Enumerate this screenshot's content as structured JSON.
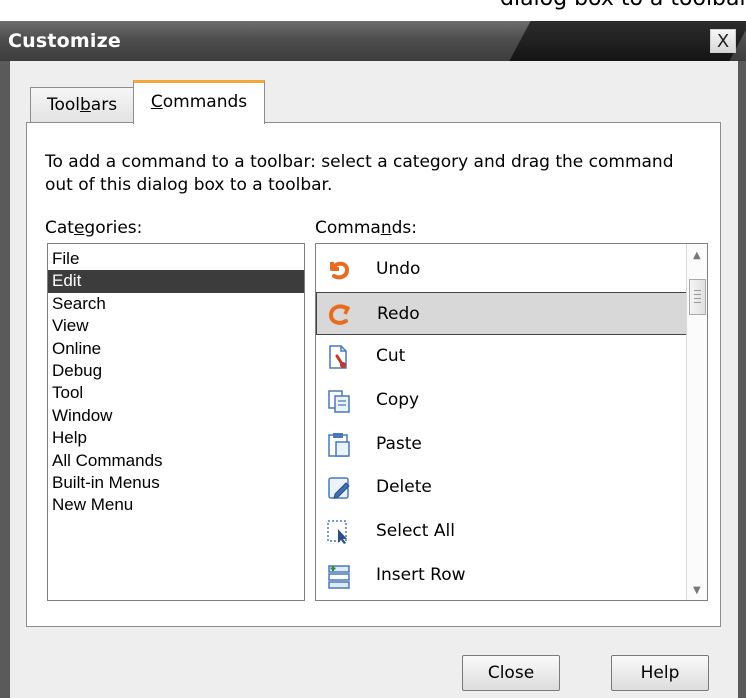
{
  "background_text": "dialog box to a toolbar.",
  "window": {
    "title": "Customize",
    "close_glyph": "X"
  },
  "tabs": [
    {
      "label": "Toolbars",
      "active": false
    },
    {
      "label": "Commands",
      "active": true
    }
  ],
  "instructions": "To add a command to a toolbar: select a category and drag the command out of this dialog box to a toolbar.",
  "categories": {
    "label": "Categories:",
    "selected": "Edit",
    "items": [
      "File",
      "Edit",
      "Search",
      "View",
      "Online",
      "Debug",
      "Tool",
      "Window",
      "Help",
      "All Commands",
      "Built-in Menus",
      "New Menu"
    ]
  },
  "commands": {
    "label": "Commands:",
    "selected": "Redo",
    "items": [
      {
        "label": "Undo",
        "icon": "undo-icon"
      },
      {
        "label": "Redo",
        "icon": "redo-icon"
      },
      {
        "label": "Cut",
        "icon": "cut-icon"
      },
      {
        "label": "Copy",
        "icon": "copy-icon"
      },
      {
        "label": "Paste",
        "icon": "paste-icon"
      },
      {
        "label": "Delete",
        "icon": "delete-icon"
      },
      {
        "label": "Select All",
        "icon": "select-all-icon"
      },
      {
        "label": "Insert Row",
        "icon": "insert-row-icon"
      }
    ]
  },
  "buttons": {
    "close": "Close",
    "help": "Help"
  },
  "colors": {
    "accent_tab": "#f1a93c",
    "selection": "#3c3c3c",
    "undo_redo_icon": "#e86b1f"
  }
}
